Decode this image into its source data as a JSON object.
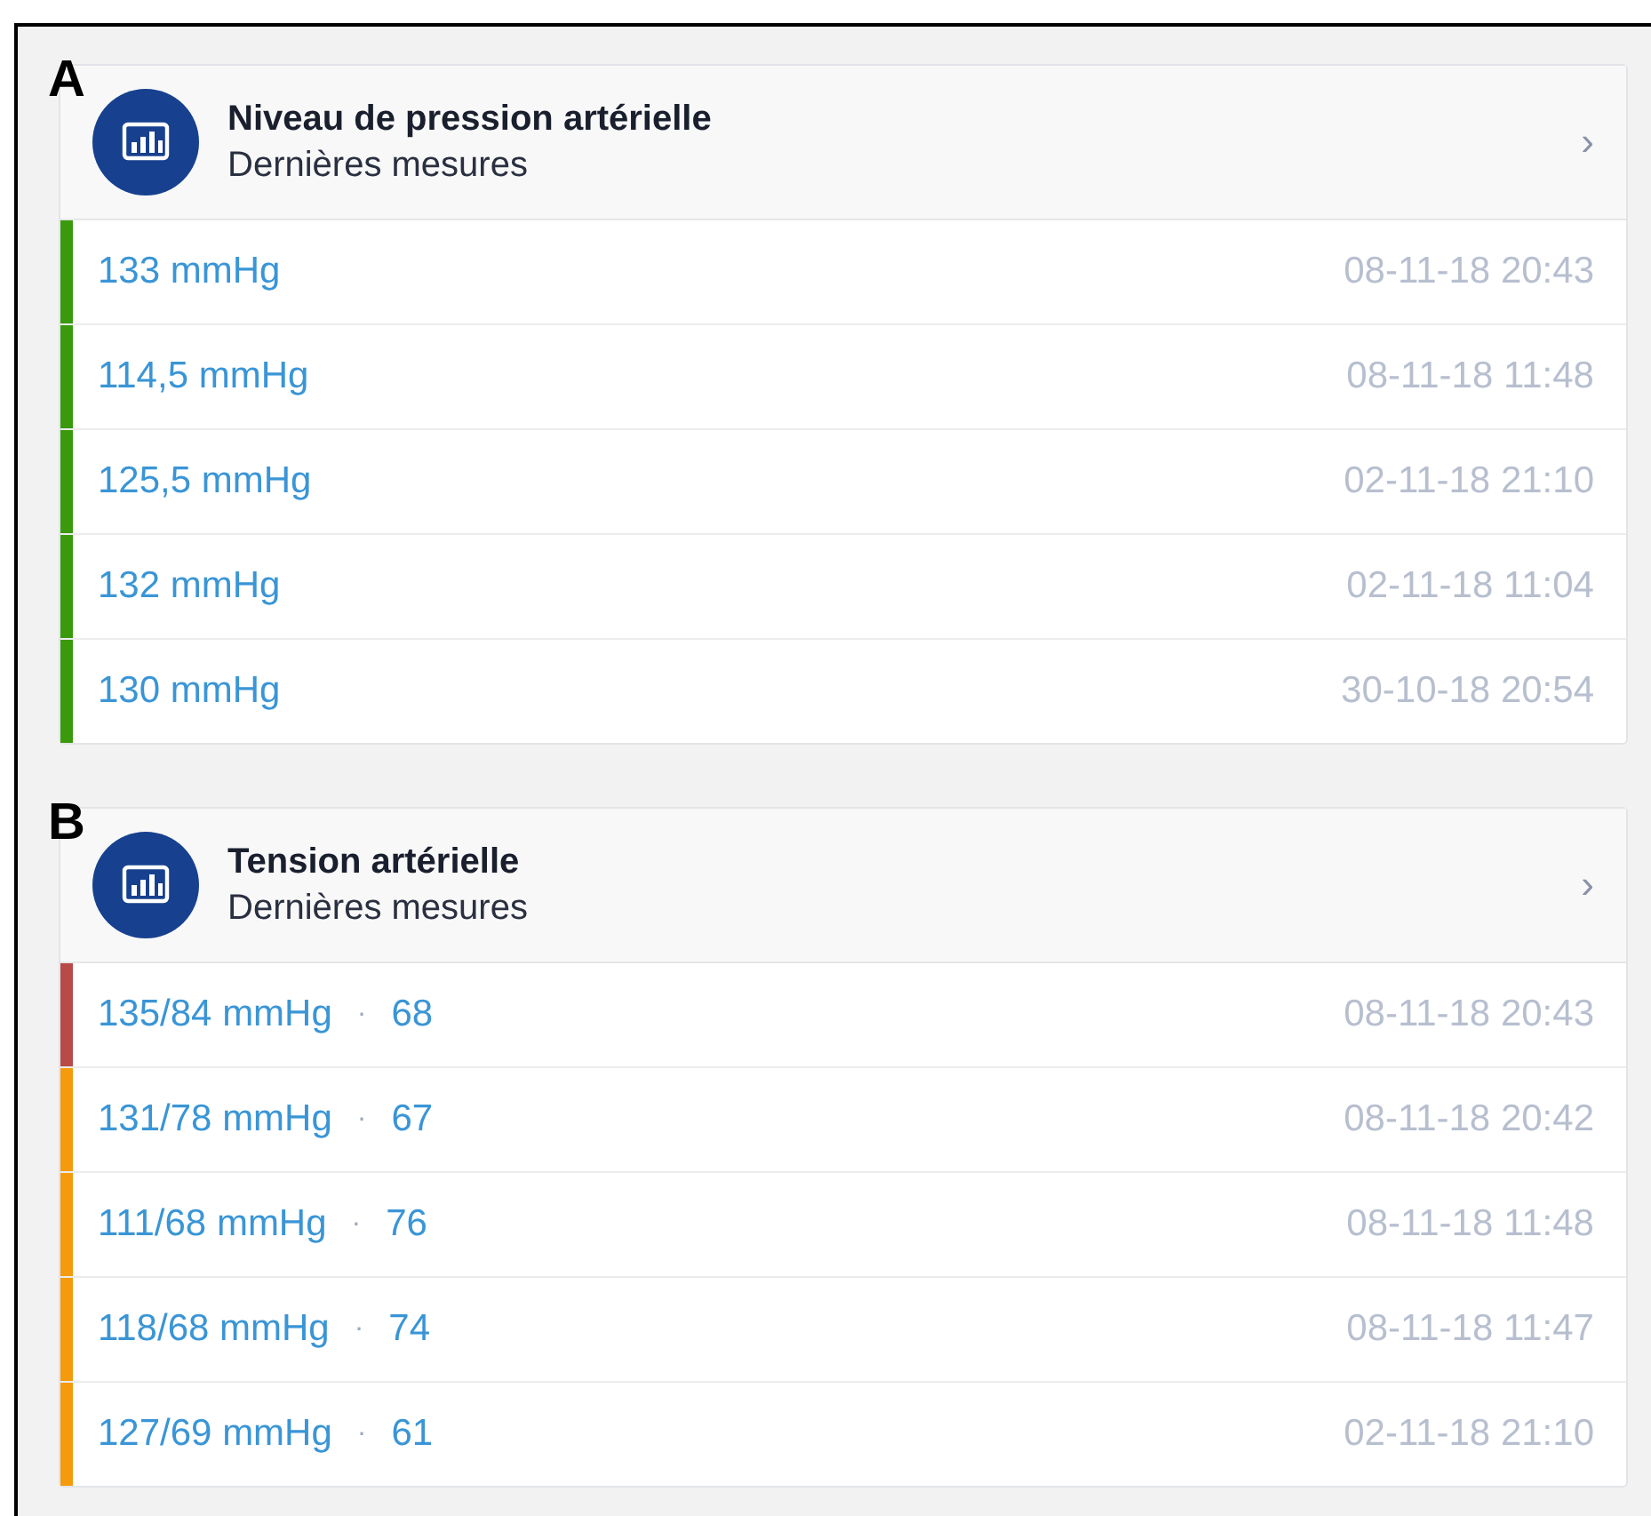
{
  "panels": [
    {
      "letter": "A",
      "title": "Niveau de pression artérielle",
      "subtitle": "Dernières mesures",
      "chevron": "›",
      "rows": [
        {
          "reading": "133 mmHg",
          "date": "08-11-18 20:43",
          "color": "#3a9a0c"
        },
        {
          "reading": "114,5 mmHg",
          "date": "08-11-18 11:48",
          "color": "#3a9a0c"
        },
        {
          "reading": "125,5 mmHg",
          "date": "02-11-18 21:10",
          "color": "#3a9a0c"
        },
        {
          "reading": "132 mmHg",
          "date": "02-11-18 11:04",
          "color": "#3a9a0c"
        },
        {
          "reading": "130 mmHg",
          "date": "30-10-18 20:54",
          "color": "#3a9a0c"
        }
      ]
    },
    {
      "letter": "B",
      "title": "Tension artérielle",
      "subtitle": "Dernières mesures",
      "chevron": "›",
      "rows": [
        {
          "reading": "135/84 mmHg",
          "separator": "·",
          "pulse": "68",
          "date": "08-11-18 20:43",
          "color": "#b84a48"
        },
        {
          "reading": "131/78 mmHg",
          "separator": "·",
          "pulse": "67",
          "date": "08-11-18 20:42",
          "color": "#f59a0c"
        },
        {
          "reading": "111/68 mmHg",
          "separator": "·",
          "pulse": "76",
          "date": "08-11-18 11:48",
          "color": "#f59a0c"
        },
        {
          "reading": "118/68 mmHg",
          "separator": "·",
          "pulse": "74",
          "date": "08-11-18 11:47",
          "color": "#f59a0c"
        },
        {
          "reading": "127/69 mmHg",
          "separator": "·",
          "pulse": "61",
          "date": "02-11-18 21:10",
          "color": "#f59a0c"
        }
      ]
    }
  ]
}
